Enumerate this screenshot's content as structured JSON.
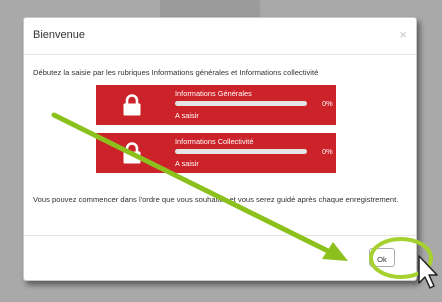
{
  "modal": {
    "title": "Bienvenue",
    "close_glyph": "×",
    "intro": "Débutez la saisie par les rubriques Informations générales et Informations collectivité",
    "cards": [
      {
        "title": "Informations Générales",
        "progress_percent": 0,
        "percent_label": "0%",
        "status": "A saisir",
        "icon": "lock-icon"
      },
      {
        "title": "Informations Collectivité",
        "progress_percent": 0,
        "percent_label": "0%",
        "status": "A saisir",
        "icon": "lock-icon"
      }
    ],
    "guidance": "Vous pouvez commencer dans l'ordre que vous souhaitez et vous serez guidé après chaque enregistrement.",
    "ok_label": "Ok"
  },
  "colors": {
    "card_red": "#cc2229",
    "annotation_green": "#8cc01c"
  }
}
